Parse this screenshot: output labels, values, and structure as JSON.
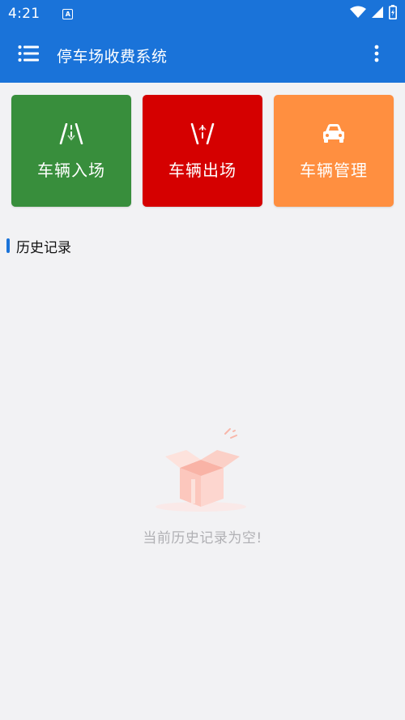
{
  "status": {
    "time": "4:21",
    "app_icon_letter": "A"
  },
  "appbar": {
    "title": "停车场收费系统"
  },
  "actions": [
    {
      "label": "车辆入场",
      "color": "#388e3c",
      "icon": "road-entry-icon"
    },
    {
      "label": "车辆出场",
      "color": "#d50000",
      "icon": "road-exit-icon"
    },
    {
      "label": "车辆管理",
      "color": "#ff8f40",
      "icon": "car-icon"
    }
  ],
  "history": {
    "title": "历史记录",
    "empty_text": "当前历史记录为空!"
  },
  "colors": {
    "primary": "#1a73d9",
    "background": "#f2f2f4"
  }
}
